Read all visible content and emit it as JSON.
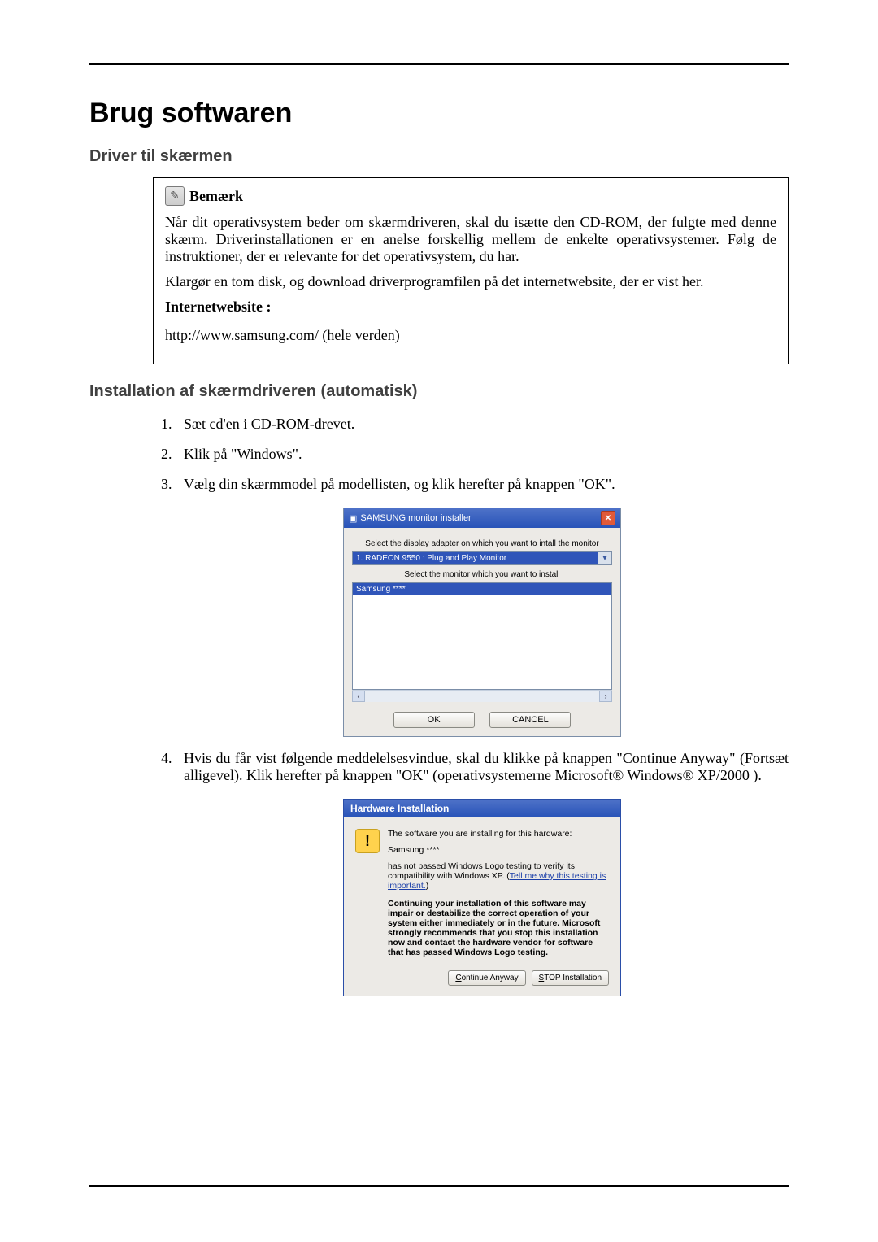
{
  "heading": "Brug softwaren",
  "section1": "Driver til skærmen",
  "note": {
    "label": "Bemærk",
    "p1": "Når dit operativsystem beder om skærmdriveren, skal du isætte den CD-ROM, der fulgte med denne skærm. Driverinstallationen er en anelse forskellig mellem de enkelte operativsystemer. Følg de instruktioner, der er relevante for det operativsystem, du har.",
    "p2": "Klargør en tom disk, og download driverprogramfilen på det internetwebsite, der er vist her.",
    "web_label": "Internetwebsite :",
    "url": "http://www.samsung.com/ (hele verden)"
  },
  "section2": "Installation af skærmdriveren (automatisk)",
  "steps": {
    "s1": "Sæt cd'en i CD-ROM-drevet.",
    "s2": "Klik på \"Windows\".",
    "s3": "Vælg din skærmmodel på modellisten, og klik herefter på knappen \"OK\".",
    "s4": "Hvis du får vist følgende meddelelsesvindue, skal du klikke på knappen \"Continue Anyway\" (Fortsæt alligevel). Klik herefter på knappen \"OK\" (operativsystemerne Microsoft® Windows® XP/2000 )."
  },
  "installer": {
    "title": "SAMSUNG monitor installer",
    "caption_adapter": "Select the display adapter on which you want to intall the monitor",
    "adapter_selected": "1. RADEON 9550 : Plug and Play Monitor",
    "caption_monitor": "Select the monitor which you want to install",
    "monitor_selected": "Samsung ****",
    "ok": "OK",
    "cancel": "CANCEL"
  },
  "hwdlg": {
    "title": "Hardware Installation",
    "line1": "The software you are installing for this hardware:",
    "line2": "Samsung ****",
    "line3a": "has not passed Windows Logo testing to verify its compatibility with Windows XP. (",
    "link": "Tell me why this testing is important.",
    "line3b": ")",
    "bold": "Continuing your installation of this software may impair or destabilize the correct operation of your system either immediately or in the future. Microsoft strongly recommends that you stop this installation now and contact the hardware vendor for software that has passed Windows Logo testing.",
    "btn_continue_pre": "C",
    "btn_continue_post": "ontinue Anyway",
    "btn_stop_pre": "S",
    "btn_stop_post": "TOP Installation"
  }
}
